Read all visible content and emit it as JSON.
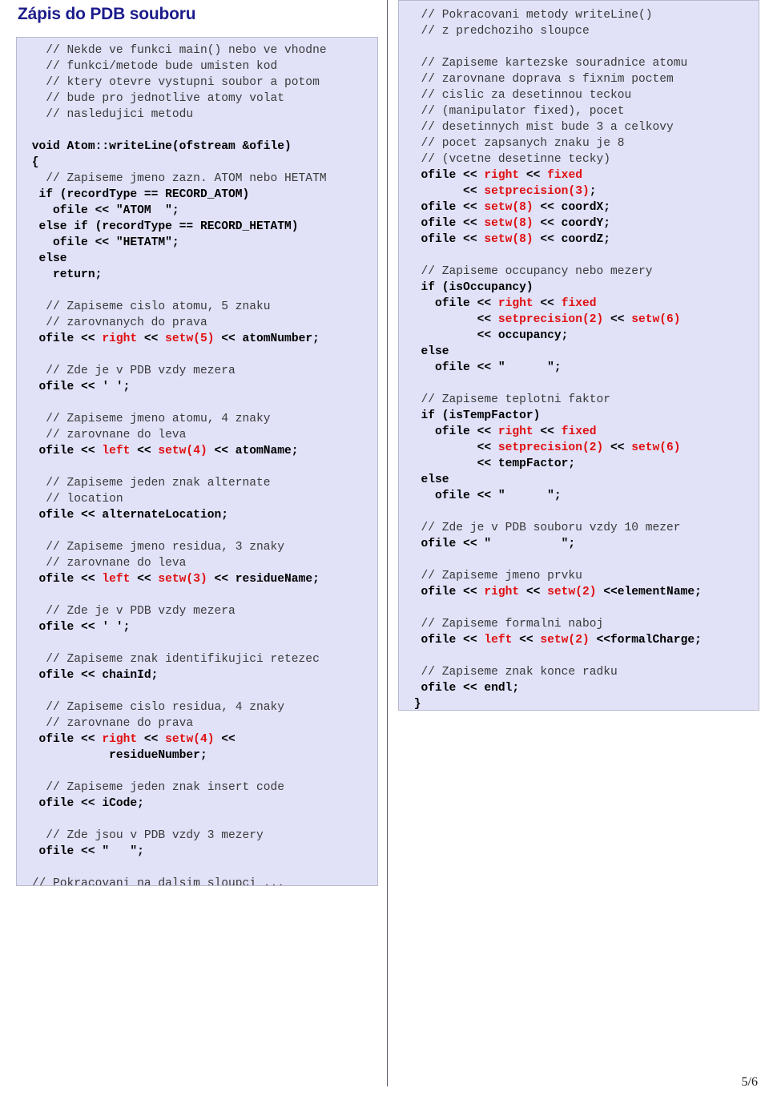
{
  "slide": {
    "title": "Zápis do PDB souboru",
    "page_number": "5/6",
    "colors": {
      "title": "#1c1c8c",
      "code_background": "#e1e1f8",
      "code_border": "#b9b9cc",
      "keyword": "#e01010",
      "comment": "#3a3a3a",
      "code_text": "#000000",
      "divider": "#555566"
    }
  },
  "left_column": {
    "lines": [
      [
        {
          "t": "cmt",
          "s": "   // Nekde ve funkci main() nebo ve vhodne"
        }
      ],
      [
        {
          "t": "cmt",
          "s": "   // funkci/metode bude umisten kod"
        }
      ],
      [
        {
          "t": "cmt",
          "s": "   // ktery otevre vystupni soubor a potom"
        }
      ],
      [
        {
          "t": "cmt",
          "s": "   // bude pro jednotlive atomy volat"
        }
      ],
      [
        {
          "t": "cmt",
          "s": "   // nasledujici metodu"
        }
      ],
      [],
      [
        {
          "t": "code",
          "s": " void Atom::writeLine(ofstream &ofile)"
        }
      ],
      [
        {
          "t": "code",
          "s": " {"
        }
      ],
      [
        {
          "t": "cmt",
          "s": "   // Zapiseme jmeno zazn. ATOM nebo HETATM"
        }
      ],
      [
        {
          "t": "code",
          "s": "  if (recordType == RECORD_ATOM)"
        }
      ],
      [
        {
          "t": "code",
          "s": "    ofile << \"ATOM  \";"
        }
      ],
      [
        {
          "t": "code",
          "s": "  else if (recordType == RECORD_HETATM)"
        }
      ],
      [
        {
          "t": "code",
          "s": "    ofile << \"HETATM\";"
        }
      ],
      [
        {
          "t": "code",
          "s": "  else"
        }
      ],
      [
        {
          "t": "code",
          "s": "    return;"
        }
      ],
      [],
      [
        {
          "t": "cmt",
          "s": "   // Zapiseme cislo atomu, 5 znaku"
        }
      ],
      [
        {
          "t": "cmt",
          "s": "   // zarovnanych do prava"
        }
      ],
      [
        {
          "t": "code",
          "s": "  ofile << "
        },
        {
          "t": "kw",
          "s": "right"
        },
        {
          "t": "code",
          "s": " << "
        },
        {
          "t": "kw",
          "s": "setw(5)"
        },
        {
          "t": "code",
          "s": " << atomNumber;"
        }
      ],
      [],
      [
        {
          "t": "cmt",
          "s": "   // Zde je v PDB vzdy mezera"
        }
      ],
      [
        {
          "t": "code",
          "s": "  ofile << ' ';"
        }
      ],
      [],
      [
        {
          "t": "cmt",
          "s": "   // Zapiseme jmeno atomu, 4 znaky"
        }
      ],
      [
        {
          "t": "cmt",
          "s": "   // zarovnane do leva"
        }
      ],
      [
        {
          "t": "code",
          "s": "  ofile << "
        },
        {
          "t": "kw",
          "s": "left"
        },
        {
          "t": "code",
          "s": " << "
        },
        {
          "t": "kw",
          "s": "setw(4)"
        },
        {
          "t": "code",
          "s": " << atomName;"
        }
      ],
      [],
      [
        {
          "t": "cmt",
          "s": "   // Zapiseme jeden znak alternate"
        }
      ],
      [
        {
          "t": "cmt",
          "s": "   // location"
        }
      ],
      [
        {
          "t": "code",
          "s": "  ofile << alternateLocation;"
        }
      ],
      [],
      [
        {
          "t": "cmt",
          "s": "   // Zapiseme jmeno residua, 3 znaky"
        }
      ],
      [
        {
          "t": "cmt",
          "s": "   // zarovnane do leva"
        }
      ],
      [
        {
          "t": "code",
          "s": "  ofile << "
        },
        {
          "t": "kw",
          "s": "left"
        },
        {
          "t": "code",
          "s": " << "
        },
        {
          "t": "kw",
          "s": "setw(3)"
        },
        {
          "t": "code",
          "s": " << residueName;"
        }
      ],
      [],
      [
        {
          "t": "cmt",
          "s": "   // Zde je v PDB vzdy mezera"
        }
      ],
      [
        {
          "t": "code",
          "s": "  ofile << ' ';"
        }
      ],
      [],
      [
        {
          "t": "cmt",
          "s": "   // Zapiseme znak identifikujici retezec"
        }
      ],
      [
        {
          "t": "code",
          "s": "  ofile << chainId;"
        }
      ],
      [],
      [
        {
          "t": "cmt",
          "s": "   // Zapiseme cislo residua, 4 znaky"
        }
      ],
      [
        {
          "t": "cmt",
          "s": "   // zarovnane do prava"
        }
      ],
      [
        {
          "t": "code",
          "s": "  ofile << "
        },
        {
          "t": "kw",
          "s": "right"
        },
        {
          "t": "code",
          "s": " << "
        },
        {
          "t": "kw",
          "s": "setw(4)"
        },
        {
          "t": "code",
          "s": " <<"
        }
      ],
      [
        {
          "t": "code",
          "s": "            residueNumber;"
        }
      ],
      [],
      [
        {
          "t": "cmt",
          "s": "   // Zapiseme jeden znak insert code"
        }
      ],
      [
        {
          "t": "code",
          "s": "  ofile << iCode;"
        }
      ],
      [],
      [
        {
          "t": "cmt",
          "s": "   // Zde jsou v PDB vzdy 3 mezery"
        }
      ],
      [
        {
          "t": "code",
          "s": "  ofile << \"   \";"
        }
      ],
      [],
      [
        {
          "t": "cmt",
          "s": " // Pokracovani na dalsim sloupci ..."
        }
      ]
    ]
  },
  "right_column": {
    "lines": [
      [
        {
          "t": "cmt",
          "s": "  // Pokracovani metody writeLine()"
        }
      ],
      [
        {
          "t": "cmt",
          "s": "  // z predchoziho sloupce"
        }
      ],
      [],
      [
        {
          "t": "cmt",
          "s": "  // Zapiseme kartezske souradnice atomu"
        }
      ],
      [
        {
          "t": "cmt",
          "s": "  // zarovnane doprava s fixnim poctem"
        }
      ],
      [
        {
          "t": "cmt",
          "s": "  // cislic za desetinnou teckou"
        }
      ],
      [
        {
          "t": "cmt",
          "s": "  // (manipulator fixed), pocet"
        }
      ],
      [
        {
          "t": "cmt",
          "s": "  // desetinnych mist bude 3 a celkovy"
        }
      ],
      [
        {
          "t": "cmt",
          "s": "  // pocet zapsanych znaku je 8"
        }
      ],
      [
        {
          "t": "cmt",
          "s": "  // (vcetne desetinne tecky)"
        }
      ],
      [
        {
          "t": "code",
          "s": "  ofile << "
        },
        {
          "t": "kw",
          "s": "right"
        },
        {
          "t": "code",
          "s": " << "
        },
        {
          "t": "kw",
          "s": "fixed"
        }
      ],
      [
        {
          "t": "code",
          "s": "        << "
        },
        {
          "t": "kw",
          "s": "setprecision(3)"
        },
        {
          "t": "code",
          "s": ";"
        }
      ],
      [
        {
          "t": "code",
          "s": "  ofile << "
        },
        {
          "t": "kw",
          "s": "setw(8)"
        },
        {
          "t": "code",
          "s": " << coordX;"
        }
      ],
      [
        {
          "t": "code",
          "s": "  ofile << "
        },
        {
          "t": "kw",
          "s": "setw(8)"
        },
        {
          "t": "code",
          "s": " << coordY;"
        }
      ],
      [
        {
          "t": "code",
          "s": "  ofile << "
        },
        {
          "t": "kw",
          "s": "setw(8)"
        },
        {
          "t": "code",
          "s": " << coordZ;"
        }
      ],
      [],
      [
        {
          "t": "cmt",
          "s": "  // Zapiseme occupancy nebo mezery"
        }
      ],
      [
        {
          "t": "code",
          "s": "  if (isOccupancy)"
        }
      ],
      [
        {
          "t": "code",
          "s": "    ofile << "
        },
        {
          "t": "kw",
          "s": "right"
        },
        {
          "t": "code",
          "s": " << "
        },
        {
          "t": "kw",
          "s": "fixed"
        }
      ],
      [
        {
          "t": "code",
          "s": "          << "
        },
        {
          "t": "kw",
          "s": "setprecision(2)"
        },
        {
          "t": "code",
          "s": " << "
        },
        {
          "t": "kw",
          "s": "setw(6)"
        }
      ],
      [
        {
          "t": "code",
          "s": "          << occupancy;"
        }
      ],
      [
        {
          "t": "code",
          "s": "  else"
        }
      ],
      [
        {
          "t": "code",
          "s": "    ofile << \"      \";"
        }
      ],
      [],
      [
        {
          "t": "cmt",
          "s": "  // Zapiseme teplotni faktor"
        }
      ],
      [
        {
          "t": "code",
          "s": "  if (isTempFactor)"
        }
      ],
      [
        {
          "t": "code",
          "s": "    ofile << "
        },
        {
          "t": "kw",
          "s": "right"
        },
        {
          "t": "code",
          "s": " << "
        },
        {
          "t": "kw",
          "s": "fixed"
        }
      ],
      [
        {
          "t": "code",
          "s": "          << "
        },
        {
          "t": "kw",
          "s": "setprecision(2)"
        },
        {
          "t": "code",
          "s": " << "
        },
        {
          "t": "kw",
          "s": "setw(6)"
        }
      ],
      [
        {
          "t": "code",
          "s": "          << tempFactor;"
        }
      ],
      [
        {
          "t": "code",
          "s": "  else"
        }
      ],
      [
        {
          "t": "code",
          "s": "    ofile << \"      \";"
        }
      ],
      [],
      [
        {
          "t": "cmt",
          "s": "  // Zde je v PDB souboru vzdy 10 mezer"
        }
      ],
      [
        {
          "t": "code",
          "s": "  ofile << \"          \";"
        }
      ],
      [],
      [
        {
          "t": "cmt",
          "s": "  // Zapiseme jmeno prvku"
        }
      ],
      [
        {
          "t": "code",
          "s": "  ofile << "
        },
        {
          "t": "kw",
          "s": "right"
        },
        {
          "t": "code",
          "s": " << "
        },
        {
          "t": "kw",
          "s": "setw(2)"
        },
        {
          "t": "code",
          "s": " <<elementName;"
        }
      ],
      [],
      [
        {
          "t": "cmt",
          "s": "  // Zapiseme formalni naboj"
        }
      ],
      [
        {
          "t": "code",
          "s": "  ofile << "
        },
        {
          "t": "kw",
          "s": "left"
        },
        {
          "t": "code",
          "s": " << "
        },
        {
          "t": "kw",
          "s": "setw(2)"
        },
        {
          "t": "code",
          "s": " <<formalCharge;"
        }
      ],
      [],
      [
        {
          "t": "cmt",
          "s": "  // Zapiseme znak konce radku"
        }
      ],
      [
        {
          "t": "code",
          "s": "  ofile << endl;"
        }
      ],
      [
        {
          "t": "code",
          "s": " }"
        }
      ]
    ]
  }
}
